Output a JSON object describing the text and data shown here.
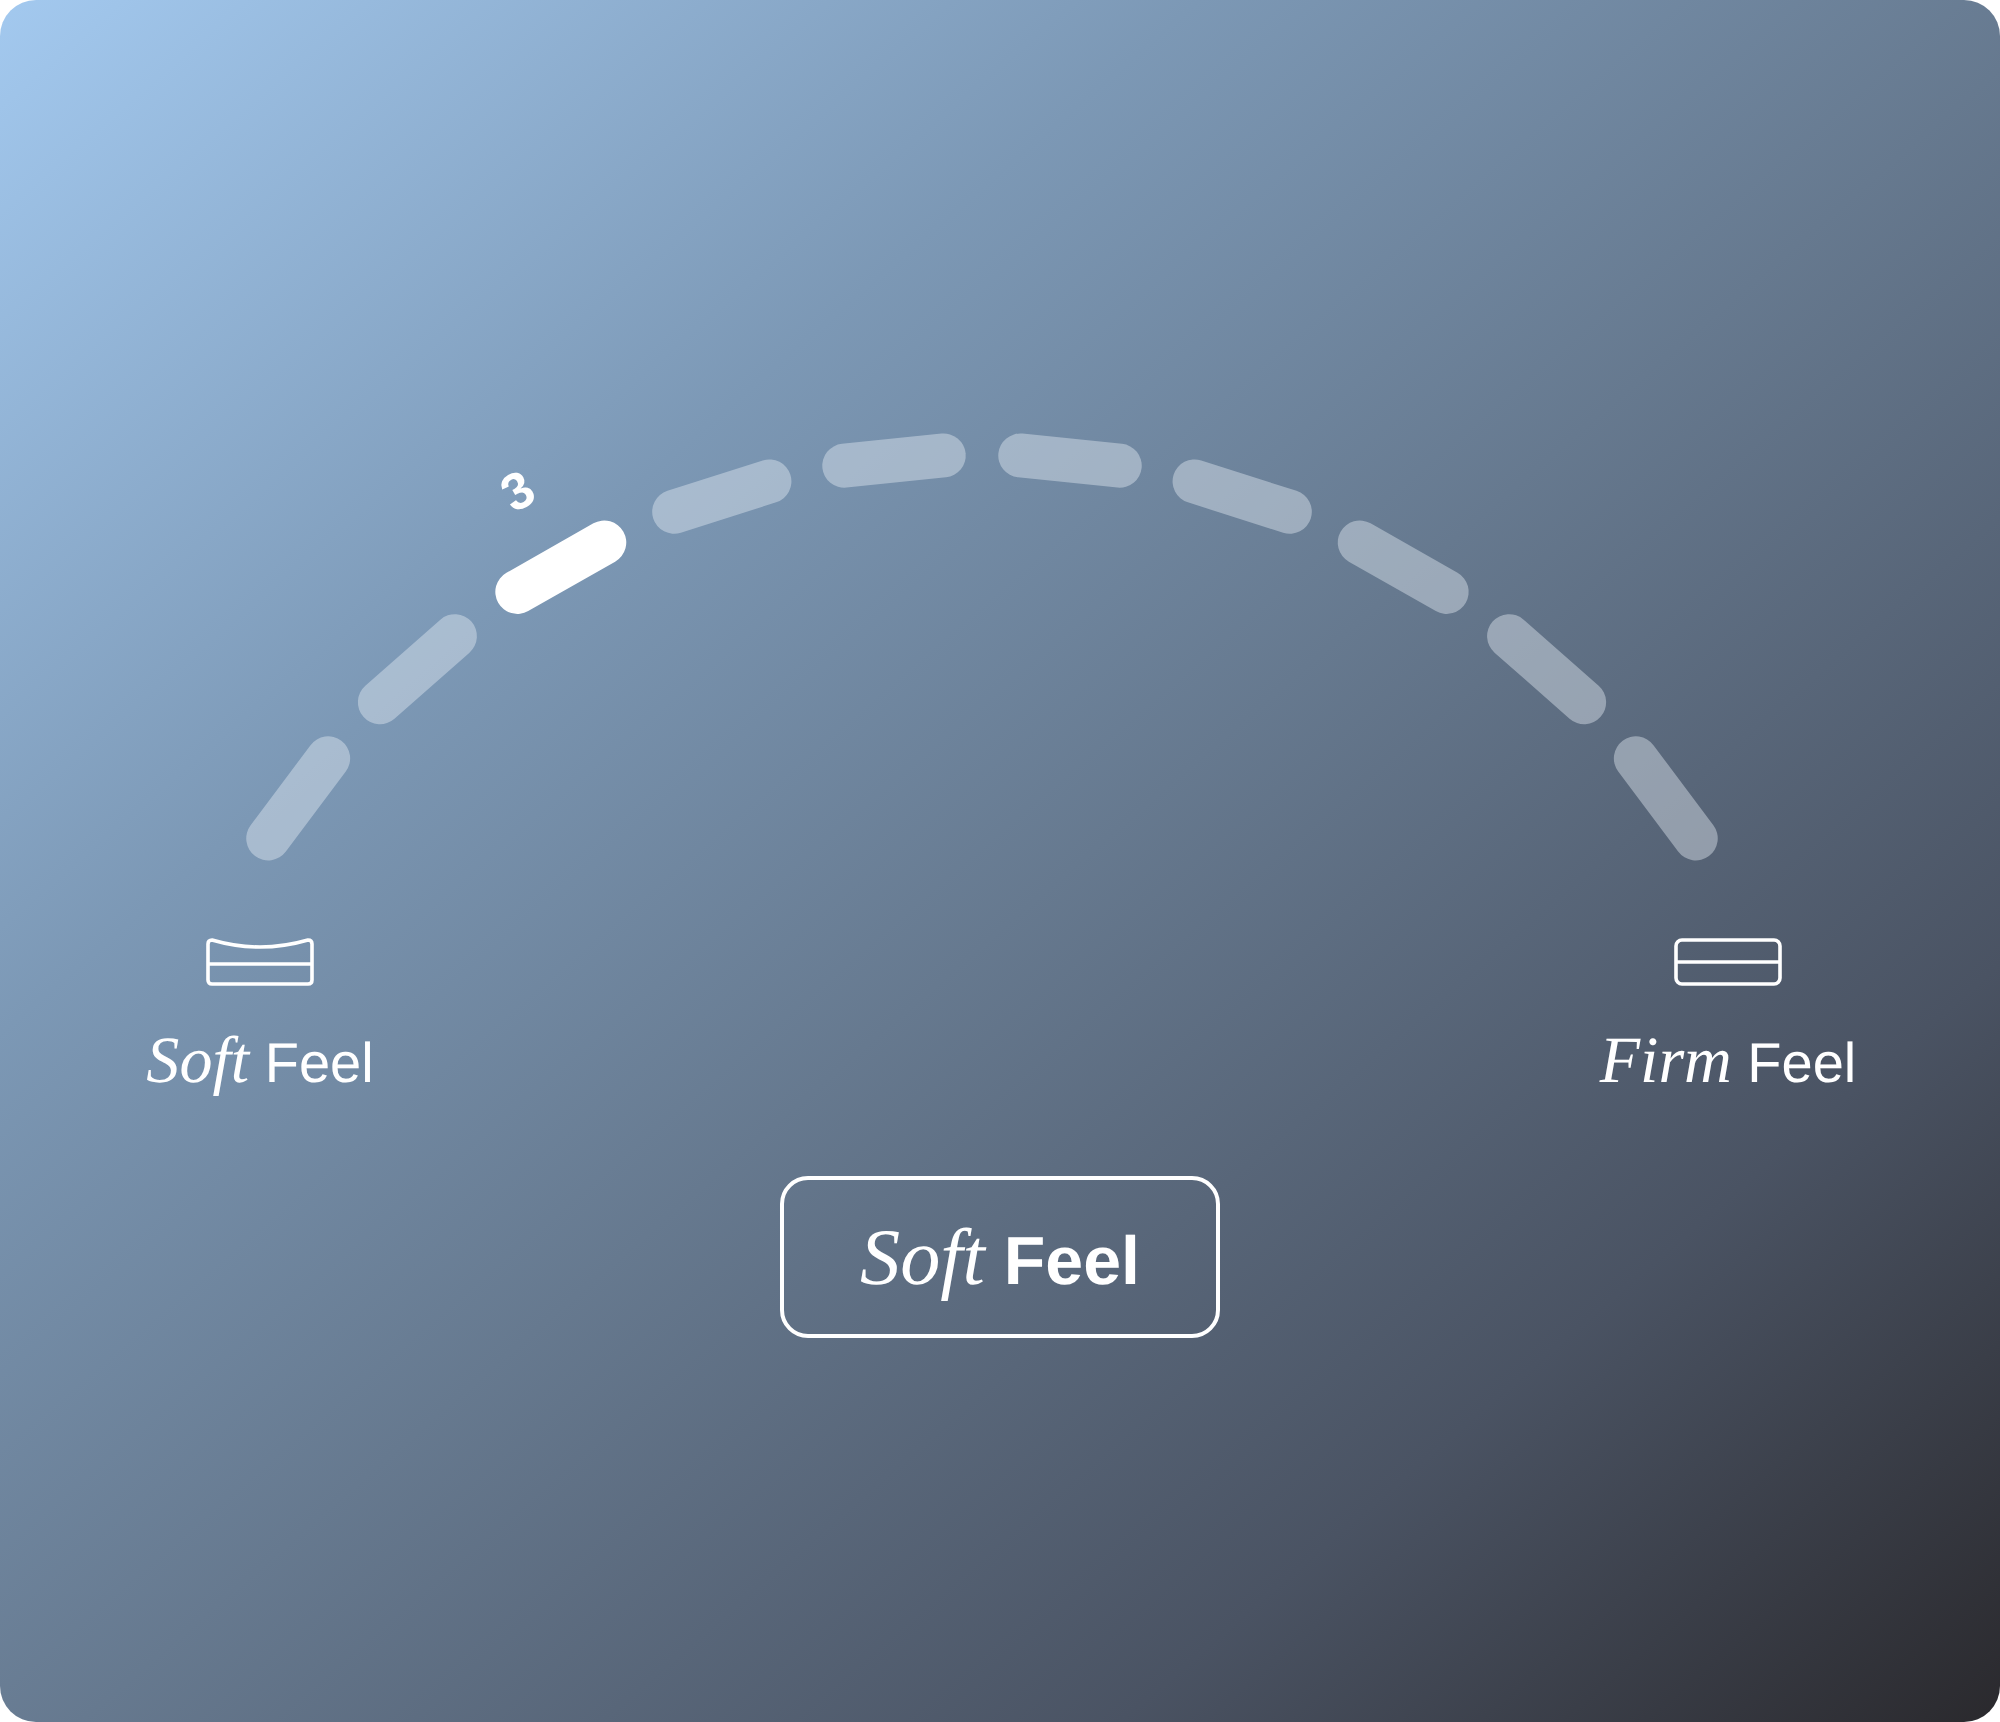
{
  "dial": {
    "segments": [
      {
        "selected": false
      },
      {
        "selected": false
      },
      {
        "selected": true
      },
      {
        "selected": false
      },
      {
        "selected": false
      },
      {
        "selected": false
      },
      {
        "selected": false
      },
      {
        "selected": false
      },
      {
        "selected": false
      },
      {
        "selected": false
      }
    ],
    "value_label": "3"
  },
  "ends": [
    {
      "kind": "soft",
      "label": "*Soft* Feel"
    },
    {
      "kind": "firm",
      "label": "*Firm* Feel"
    }
  ],
  "selection": {
    "label": "*Soft* Feel"
  }
}
